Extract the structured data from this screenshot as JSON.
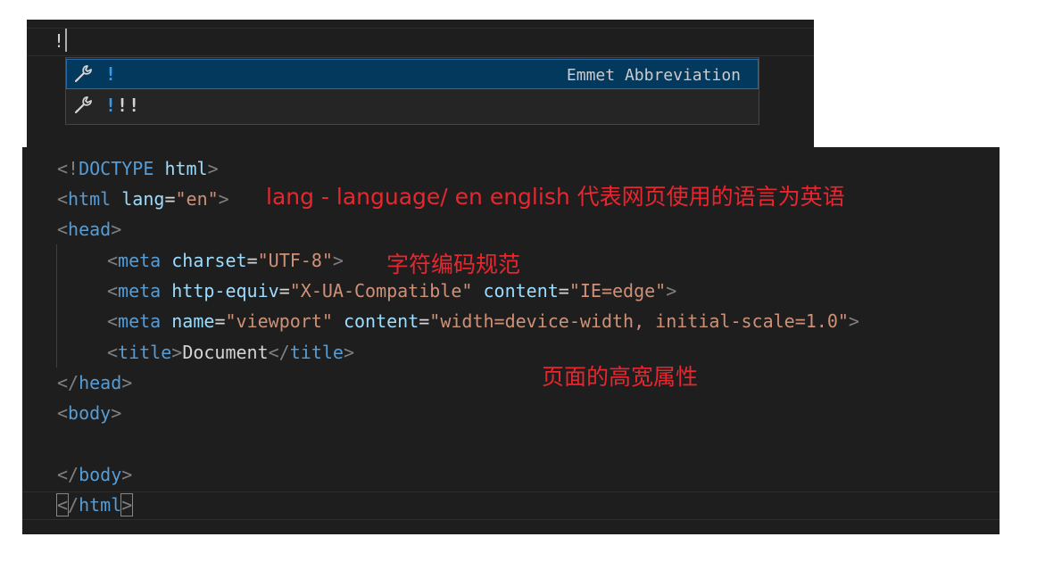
{
  "editor_top": {
    "typed_text": "!",
    "suggestions": [
      {
        "prefix": "!",
        "rest": "",
        "detail": "Emmet Abbreviation",
        "icon": "wrench-icon",
        "selected": true
      },
      {
        "prefix": "!",
        "rest": "!!",
        "detail": "",
        "icon": "wrench-icon",
        "selected": false
      }
    ]
  },
  "code": {
    "line1": {
      "open": "<!",
      "kw": "DOCTYPE",
      "sp": " ",
      "html": "html",
      "close": ">"
    },
    "line2": {
      "lt": "<",
      "tag": "html",
      "attr": "lang",
      "eq": "=",
      "val": "\"en\"",
      "gt": ">"
    },
    "line3": {
      "lt": "<",
      "tag": "head",
      "gt": ">"
    },
    "line4": {
      "lt": "<",
      "tag": "meta",
      "attr": "charset",
      "eq": "=",
      "val": "\"UTF-8\"",
      "gt": ">"
    },
    "line5": {
      "lt": "<",
      "tag": "meta",
      "attr1": "http-equiv",
      "eq1": "=",
      "val1": "\"X-UA-Compatible\"",
      "attr2": "content",
      "eq2": "=",
      "val2": "\"IE=edge\"",
      "gt": ">"
    },
    "line6": {
      "lt": "<",
      "tag": "meta",
      "attr1": "name",
      "eq1": "=",
      "val1": "\"viewport\"",
      "attr2": "content",
      "eq2": "=",
      "val2": "\"width=device-width, initial-scale=1.0\"",
      "gt": ">"
    },
    "line7": {
      "lt": "<",
      "tag": "title",
      "gt": ">",
      "text": "Document",
      "lt2": "</",
      "tag2": "title",
      "gt2": ">"
    },
    "line8": {
      "lt": "</",
      "tag": "head",
      "gt": ">"
    },
    "line9": {
      "lt": "<",
      "tag": "body",
      "gt": ">"
    },
    "line11": {
      "lt": "</",
      "tag": "body",
      "gt": ">"
    },
    "line12": {
      "lt": "<",
      "slash": "/",
      "tag": "html",
      "gt": ">"
    }
  },
  "annotations": {
    "lang_note": "lang - language/ en english 代表网页使用的语言为英语",
    "charset_note": "字符编码规范",
    "viewport_note": "页面的高宽属性"
  },
  "colors": {
    "editor_bg": "#1e1e1e",
    "tag": "#569cd6",
    "attribute": "#9cdcfe",
    "string": "#ce9178",
    "annotation": "#e8262f",
    "suggest_selected": "#04395e"
  }
}
